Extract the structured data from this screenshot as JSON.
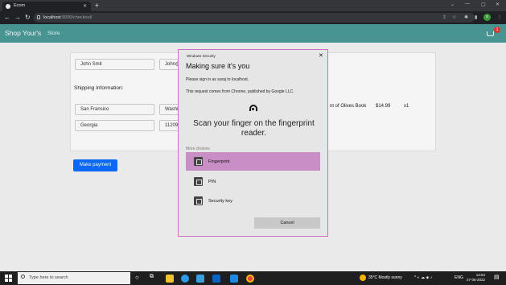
{
  "browser": {
    "tab_title": "Ecom",
    "tab_close": "✕",
    "new_tab": "+",
    "window_controls": [
      "⌄",
      "—",
      "▢",
      "✕"
    ],
    "url_host": "localhost",
    "url_path": ":9000/checkout/",
    "profile_initial": "s"
  },
  "navbar": {
    "brand": "Shop Your's",
    "store_link": "Store",
    "cart_count": "1"
  },
  "checkout": {
    "name_value": "John Smit",
    "email_value": "John@",
    "shipping_label": "Shipping Information:",
    "city_value": "San Fransico",
    "state_value": "Washi",
    "country_value": "Georgia",
    "zip_value": "11209",
    "item_name": "nt of Olives Book",
    "item_price": "$14.99",
    "item_qty": "x1",
    "pay_button": "Make payment"
  },
  "dialog": {
    "caption": "Windows Security",
    "close": "✕",
    "title": "Making sure it's you",
    "line1": "Please sign in as suraj to localhost.",
    "line2": "This request comes from Chrome, published by Google LLC.",
    "scan_text": "Scan your finger on the fingerprint reader.",
    "more_choices": "More choices",
    "options": [
      {
        "label": "Fingerprint",
        "icon": "fingerprint-icon",
        "selected": true
      },
      {
        "label": "PIN",
        "icon": "pin-keypad-icon",
        "selected": false
      },
      {
        "label": "Security key",
        "icon": "security-key-icon",
        "selected": false
      }
    ],
    "cancel": "Cancel"
  },
  "taskbar": {
    "search_placeholder": "Type here to search",
    "weather": "35°C  Mostly sunny",
    "lang": "ENG",
    "time": "14:54",
    "date": "27-05-2022"
  },
  "colors": {
    "navbar_teal": "#4a9b9a",
    "pay_blue": "#0d6efd",
    "selected_option": "#c98ec6",
    "dialog_border": "#c76fc0",
    "cart_badge": "#e53935"
  }
}
